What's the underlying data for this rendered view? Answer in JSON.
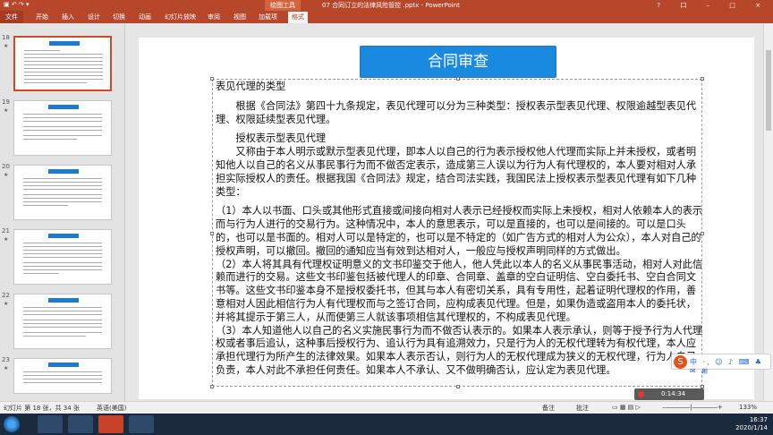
{
  "titlebar": {
    "title": "07 合同订立的法律风险管控 .pptx - PowerPoint",
    "context_tab": "绘图工具",
    "window_controls": "? 口 – □ ×"
  },
  "ribbon": {
    "file": "文件",
    "tabs": [
      "开始",
      "插入",
      "设计",
      "切换",
      "动画",
      "幻灯片放映",
      "审阅",
      "视图",
      "加载项",
      "格式"
    ]
  },
  "thumbnails": [
    {
      "num": "18",
      "star": "★"
    },
    {
      "num": "19",
      "star": "★"
    },
    {
      "num": "20",
      "star": "★"
    },
    {
      "num": "21",
      "star": "★"
    },
    {
      "num": "22",
      "star": "★"
    },
    {
      "num": "23",
      "star": "★"
    }
  ],
  "slide": {
    "title": "合同审查",
    "paragraphs": [
      "表见代理的类型",
      "",
      "　　根据《合同法》第四十九条规定，表见代理可以分为三种类型：授权表示型表见代理、权限逾越型表见代理、权限延续型表见代理。",
      "",
      "　　授权表示型表见代理",
      "　　又称由于本人明示或默示型表见代理，即本人以自己的行为表示授权他人代理而实际上并未授权，或者明知他人以自己的名义从事民事行为而不做否定表示，造成第三人误以为行为人有代理权的，本人要对相对人承担实际授权人的责任。根据我国《合同法》规定，结合司法实践，我国民法上授权表示型表见代理有如下几种类型：",
      "",
      "（1）本人以书面、口头或其他形式直接或间接向相对人表示已经授权而实际上未授权，相对人依赖本人的表示而与行为人进行的交易行为。这种情况中，本人的意思表示，可以是直接的，也可以是间接的。可以是口头的，也可以是书面的。相对人可以是特定的，也可以是不特定的（如广告方式的相对人为公众），本人对自己的授权声明，可以撤回。撤回的通知应当有效到达相对人，一般应与授权声明同样的方式做出。",
      "（2）本人将其具有代理权证明意义的文书印鉴交于他人，他人凭此以本人的名义从事民事活动，相对人对此信赖而进行的交易。这些文书印鉴包括被代理人的印章、合同章、盖章的空白证明信、空白委托书、空白合同文书等。这些文书印鉴本身不是授权委托书，但其与本人有密切关系，具有专用性，起着证明代理权的作用，善意相对人因此相信行为人有代理权而与之签订合同，应构成表见代理。但是，如果伪造或盗用本人的委托状，并将其提示于第三人，从而使第三人就该事项相信其代理权的，不构成表见代理。",
      "（3）本人知道他人以自己的名义实施民事行为而不做否认表示的。如果本人表示承认，则等于授予行为人代理权或者事后追认，这种事后授权行为、追认行为具有追溯效力，只是行为人的无权代理转为有权代理，本人应承担代理行为所产生的法律效果。如果本人表示否认，则行为人的无权代理成为狭义的无权代理，行为人自己负责，本人对此不承担任何责任。如果本人不承认、又不做明确否认，应认定为表见代理。"
    ]
  },
  "ime": {
    "logo": "S",
    "items": "中 ·, ☺ ♪ ⌨ ♣ ✉ ⊞"
  },
  "recording": {
    "time": "0:14:34"
  },
  "status": {
    "slide_info": "幻灯片 第 18 张，共 34 张",
    "language": "英语(美国)",
    "notes": "备注",
    "comments": "批注",
    "zoom": "133%"
  },
  "tray": {
    "time": "16:37",
    "date": "2020/1/14"
  }
}
